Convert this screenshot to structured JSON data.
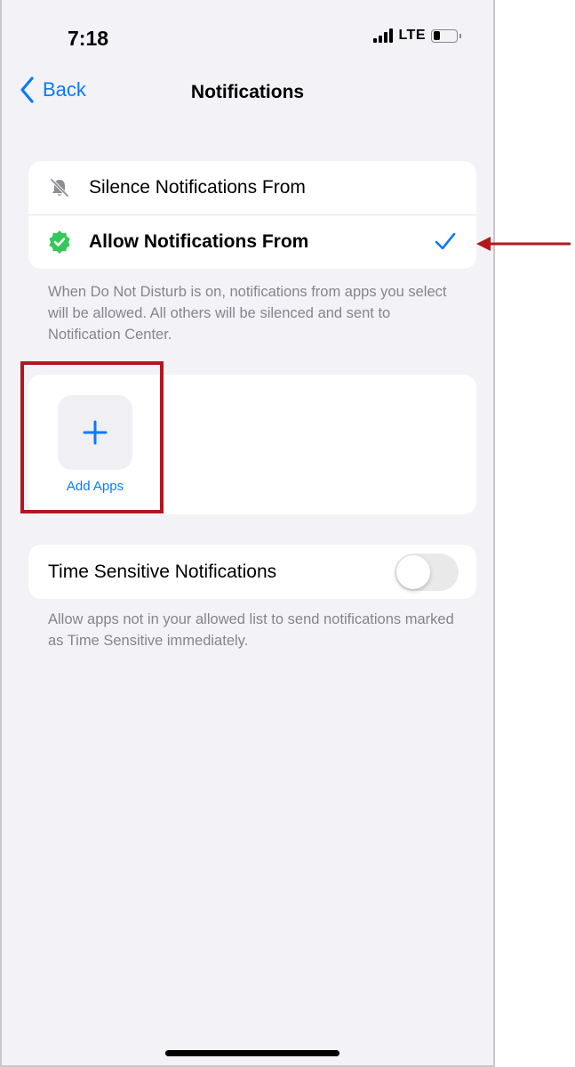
{
  "status_bar": {
    "time": "7:18",
    "network": "LTE"
  },
  "nav": {
    "back_label": "Back",
    "title": "Notifications"
  },
  "mode_options": [
    {
      "label": "Silence Notifications From",
      "icon": "bell-slash-icon",
      "selected": false
    },
    {
      "label": "Allow Notifications From",
      "icon": "checkmark-badge-icon",
      "selected": true
    }
  ],
  "mode_footnote": "When Do Not Disturb is on, notifications from apps you select will be allowed. All others will be silenced and sent to Notification Center.",
  "apps": {
    "add_label": "Add Apps"
  },
  "time_sensitive": {
    "label": "Time Sensitive Notifications",
    "enabled": false,
    "footnote": "Allow apps not in your allowed list to send notifications marked as Time Sensitive immediately."
  },
  "colors": {
    "accent": "#0a7aff",
    "badge_green": "#34c759",
    "annotation_red": "#b3171e",
    "background": "#f2f2f7"
  }
}
